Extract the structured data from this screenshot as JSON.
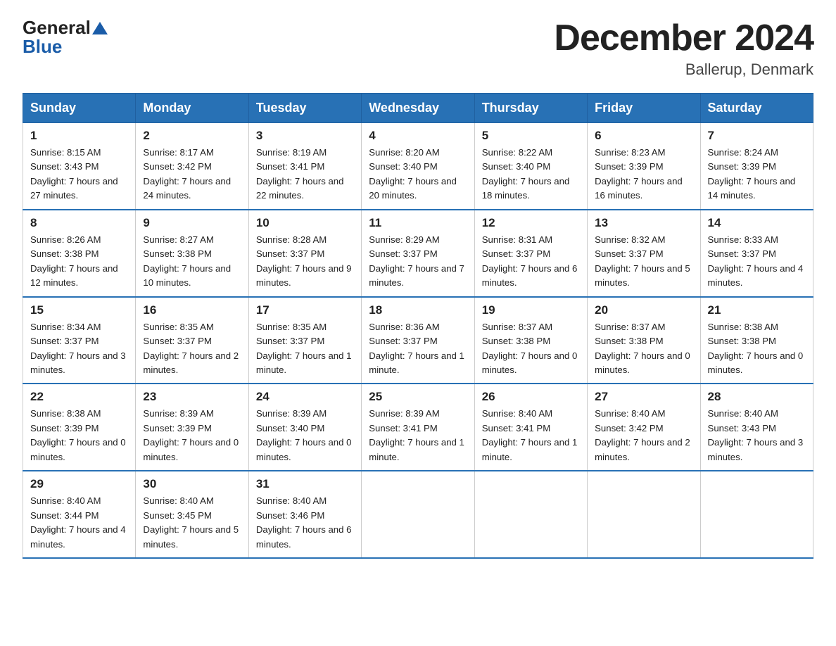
{
  "logo": {
    "general": "General",
    "blue": "Blue"
  },
  "title": "December 2024",
  "location": "Ballerup, Denmark",
  "days_of_week": [
    "Sunday",
    "Monday",
    "Tuesday",
    "Wednesday",
    "Thursday",
    "Friday",
    "Saturday"
  ],
  "weeks": [
    [
      {
        "day": "1",
        "sunrise": "8:15 AM",
        "sunset": "3:43 PM",
        "daylight": "7 hours and 27 minutes."
      },
      {
        "day": "2",
        "sunrise": "8:17 AM",
        "sunset": "3:42 PM",
        "daylight": "7 hours and 24 minutes."
      },
      {
        "day": "3",
        "sunrise": "8:19 AM",
        "sunset": "3:41 PM",
        "daylight": "7 hours and 22 minutes."
      },
      {
        "day": "4",
        "sunrise": "8:20 AM",
        "sunset": "3:40 PM",
        "daylight": "7 hours and 20 minutes."
      },
      {
        "day": "5",
        "sunrise": "8:22 AM",
        "sunset": "3:40 PM",
        "daylight": "7 hours and 18 minutes."
      },
      {
        "day": "6",
        "sunrise": "8:23 AM",
        "sunset": "3:39 PM",
        "daylight": "7 hours and 16 minutes."
      },
      {
        "day": "7",
        "sunrise": "8:24 AM",
        "sunset": "3:39 PM",
        "daylight": "7 hours and 14 minutes."
      }
    ],
    [
      {
        "day": "8",
        "sunrise": "8:26 AM",
        "sunset": "3:38 PM",
        "daylight": "7 hours and 12 minutes."
      },
      {
        "day": "9",
        "sunrise": "8:27 AM",
        "sunset": "3:38 PM",
        "daylight": "7 hours and 10 minutes."
      },
      {
        "day": "10",
        "sunrise": "8:28 AM",
        "sunset": "3:37 PM",
        "daylight": "7 hours and 9 minutes."
      },
      {
        "day": "11",
        "sunrise": "8:29 AM",
        "sunset": "3:37 PM",
        "daylight": "7 hours and 7 minutes."
      },
      {
        "day": "12",
        "sunrise": "8:31 AM",
        "sunset": "3:37 PM",
        "daylight": "7 hours and 6 minutes."
      },
      {
        "day": "13",
        "sunrise": "8:32 AM",
        "sunset": "3:37 PM",
        "daylight": "7 hours and 5 minutes."
      },
      {
        "day": "14",
        "sunrise": "8:33 AM",
        "sunset": "3:37 PM",
        "daylight": "7 hours and 4 minutes."
      }
    ],
    [
      {
        "day": "15",
        "sunrise": "8:34 AM",
        "sunset": "3:37 PM",
        "daylight": "7 hours and 3 minutes."
      },
      {
        "day": "16",
        "sunrise": "8:35 AM",
        "sunset": "3:37 PM",
        "daylight": "7 hours and 2 minutes."
      },
      {
        "day": "17",
        "sunrise": "8:35 AM",
        "sunset": "3:37 PM",
        "daylight": "7 hours and 1 minute."
      },
      {
        "day": "18",
        "sunrise": "8:36 AM",
        "sunset": "3:37 PM",
        "daylight": "7 hours and 1 minute."
      },
      {
        "day": "19",
        "sunrise": "8:37 AM",
        "sunset": "3:38 PM",
        "daylight": "7 hours and 0 minutes."
      },
      {
        "day": "20",
        "sunrise": "8:37 AM",
        "sunset": "3:38 PM",
        "daylight": "7 hours and 0 minutes."
      },
      {
        "day": "21",
        "sunrise": "8:38 AM",
        "sunset": "3:38 PM",
        "daylight": "7 hours and 0 minutes."
      }
    ],
    [
      {
        "day": "22",
        "sunrise": "8:38 AM",
        "sunset": "3:39 PM",
        "daylight": "7 hours and 0 minutes."
      },
      {
        "day": "23",
        "sunrise": "8:39 AM",
        "sunset": "3:39 PM",
        "daylight": "7 hours and 0 minutes."
      },
      {
        "day": "24",
        "sunrise": "8:39 AM",
        "sunset": "3:40 PM",
        "daylight": "7 hours and 0 minutes."
      },
      {
        "day": "25",
        "sunrise": "8:39 AM",
        "sunset": "3:41 PM",
        "daylight": "7 hours and 1 minute."
      },
      {
        "day": "26",
        "sunrise": "8:40 AM",
        "sunset": "3:41 PM",
        "daylight": "7 hours and 1 minute."
      },
      {
        "day": "27",
        "sunrise": "8:40 AM",
        "sunset": "3:42 PM",
        "daylight": "7 hours and 2 minutes."
      },
      {
        "day": "28",
        "sunrise": "8:40 AM",
        "sunset": "3:43 PM",
        "daylight": "7 hours and 3 minutes."
      }
    ],
    [
      {
        "day": "29",
        "sunrise": "8:40 AM",
        "sunset": "3:44 PM",
        "daylight": "7 hours and 4 minutes."
      },
      {
        "day": "30",
        "sunrise": "8:40 AM",
        "sunset": "3:45 PM",
        "daylight": "7 hours and 5 minutes."
      },
      {
        "day": "31",
        "sunrise": "8:40 AM",
        "sunset": "3:46 PM",
        "daylight": "7 hours and 6 minutes."
      },
      null,
      null,
      null,
      null
    ]
  ]
}
